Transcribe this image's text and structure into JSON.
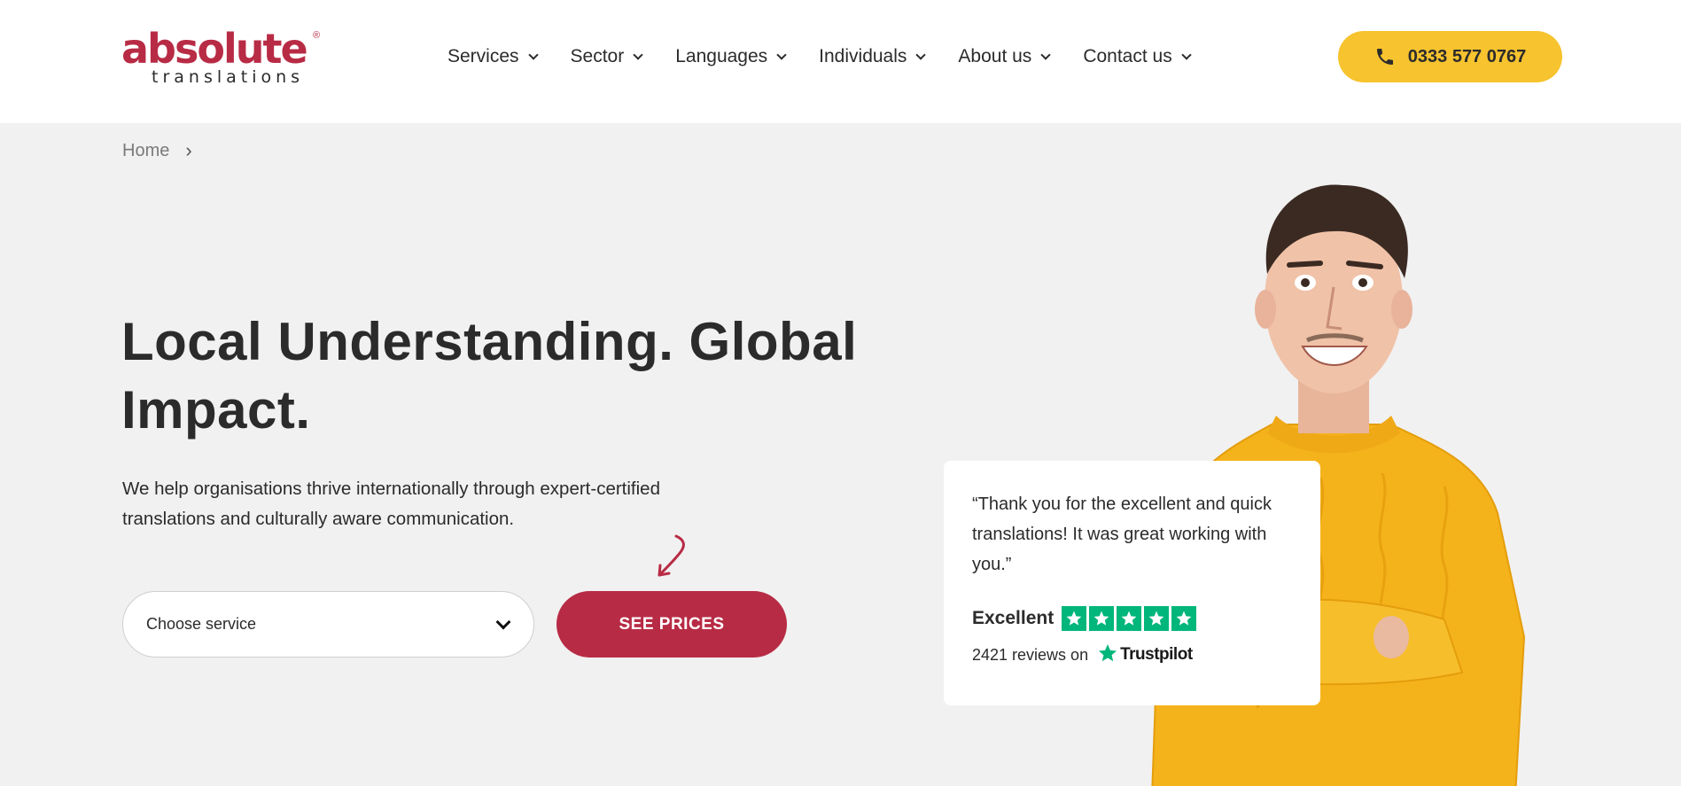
{
  "brand": {
    "logo_main": "absolute",
    "logo_reg": "®",
    "logo_sub": "translations",
    "accent_color": "#b82b45",
    "cta_color": "#f7c32e"
  },
  "nav": {
    "items": [
      {
        "label": "Services"
      },
      {
        "label": "Sector"
      },
      {
        "label": "Languages"
      },
      {
        "label": "Individuals"
      },
      {
        "label": "About us"
      },
      {
        "label": "Contact us"
      }
    ],
    "phone_label": "0333 577 0767",
    "phone_icon": "phone-icon"
  },
  "breadcrumb": {
    "home": "Home",
    "separator": "›"
  },
  "hero": {
    "title": "Local Understanding. Global Impact.",
    "description": "We help organisations thrive internationally through expert-certified translations and culturally aware communication.",
    "select_placeholder": "Choose service",
    "cta_label": "SEE PRICES"
  },
  "review": {
    "quote": "“Thank you for the excellent and quick translations! It was great working with you.”",
    "rating_label": "Excellent",
    "stars": 5,
    "count_text": "2421 reviews on",
    "platform": "Trustpilot",
    "star_color": "#00b67a"
  }
}
